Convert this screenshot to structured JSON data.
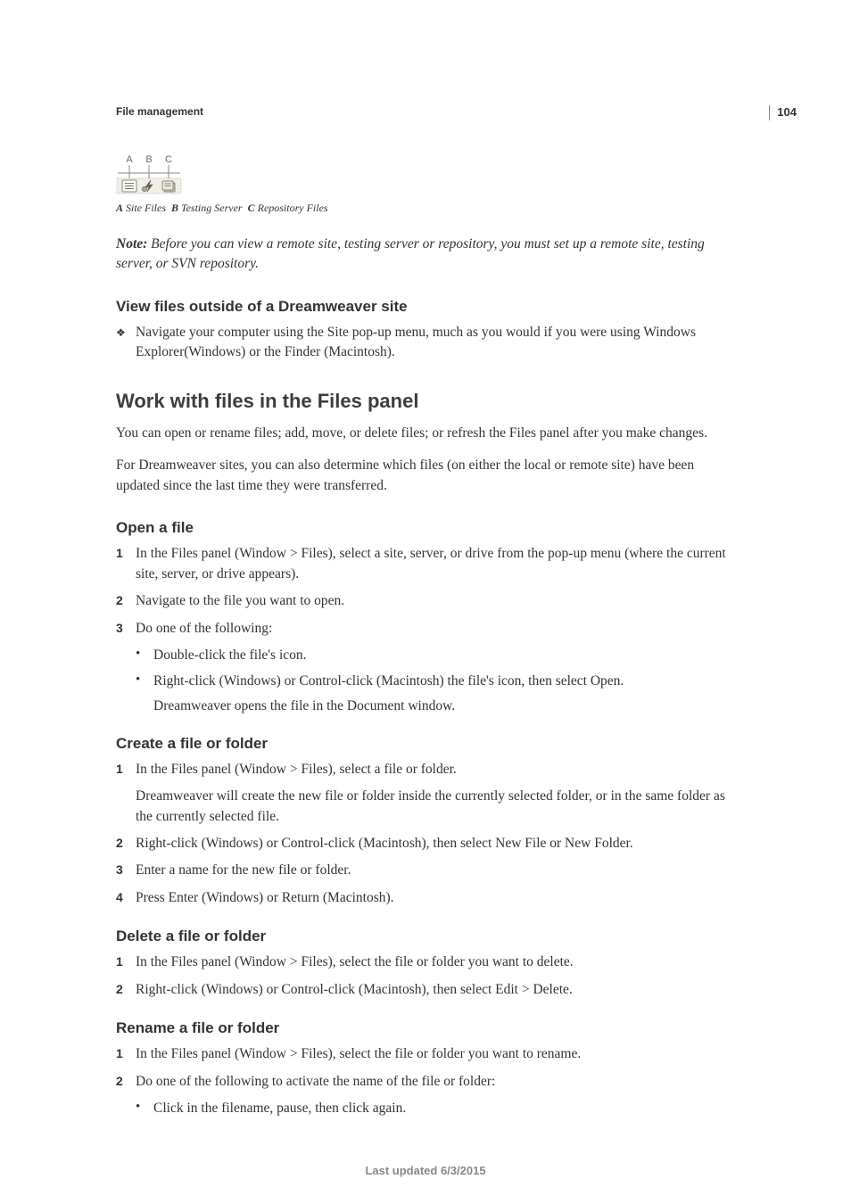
{
  "page_number": "104",
  "chapter_title": "File management",
  "diagram": {
    "labels": [
      "A",
      "B",
      "C"
    ],
    "caption_parts": [
      {
        "label": "A",
        "text": "Site Files"
      },
      {
        "label": "B",
        "text": "Testing Server"
      },
      {
        "label": "C",
        "text": "Repository Files"
      }
    ]
  },
  "note": {
    "label": "Note:",
    "text": "Before you can view a remote site, testing server or repository, you must set up a remote site, testing server, or SVN repository."
  },
  "sec_view_outside": {
    "title": "View files outside of a Dreamweaver site",
    "bullet": "Navigate your computer using the Site pop-up menu, much as you would if you were using Windows Explorer(Windows) or the Finder (Macintosh)."
  },
  "sec_work_files": {
    "title": "Work with files in the Files panel",
    "p1": "You can open or rename files; add, move, or delete files; or refresh the Files panel after you make changes.",
    "p2": "For Dreamweaver sites, you can also determine which files (on either the local or remote site) have been updated since the last time they were transferred."
  },
  "sec_open": {
    "title": "Open a file",
    "steps": [
      "In the Files panel (Window > Files), select a site, server, or drive from the pop-up menu (where the current site, server, or drive appears).",
      "Navigate to the file you want to open.",
      "Do one of the following:"
    ],
    "subs": [
      "Double-click the file's icon.",
      "Right-click (Windows) or Control-click (Macintosh) the file's icon, then select Open."
    ],
    "trail": "Dreamweaver opens the file in the Document window."
  },
  "sec_create": {
    "title": "Create a file or folder",
    "steps": [
      "In the Files panel (Window > Files), select a file or folder.",
      "Right-click (Windows) or Control-click (Macintosh), then select New File or New Folder.",
      "Enter a name for the new file or folder.",
      "Press Enter (Windows) or Return (Macintosh)."
    ],
    "step1_trail": "Dreamweaver will create the new file or folder inside the currently selected folder, or in the same folder as the currently selected file."
  },
  "sec_delete": {
    "title": "Delete a file or folder",
    "steps": [
      "In the Files panel (Window > Files), select the file or folder you want to delete.",
      "Right-click (Windows) or Control-click (Macintosh), then select Edit > Delete."
    ]
  },
  "sec_rename": {
    "title": "Rename a file or folder",
    "steps": [
      "In the Files panel (Window > Files), select the file or folder you want to rename.",
      "Do one of the following to activate the name of the file or folder:"
    ],
    "subs": [
      "Click in the filename, pause, then click again."
    ]
  },
  "footer": "Last updated 6/3/2015"
}
